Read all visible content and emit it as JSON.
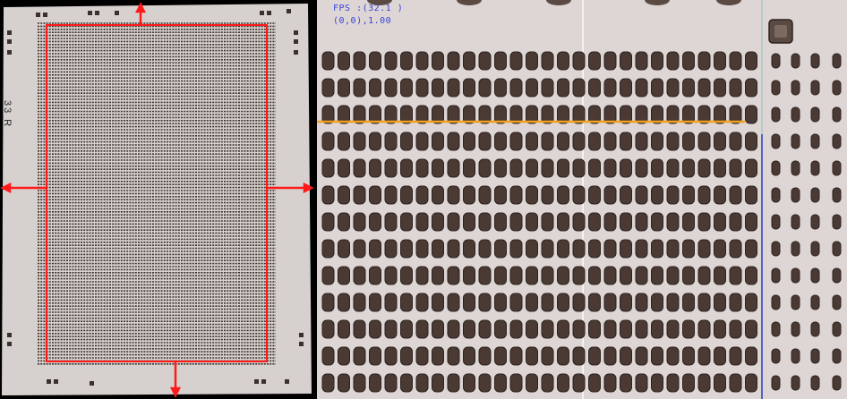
{
  "left_view": {
    "die_label": "33 R",
    "colors": {
      "die": "#d9d4d1",
      "pads": "#3b302c",
      "boundary": "#ff1a1a"
    }
  },
  "right_view": {
    "overlay_lines": [
      "FPS :(32.1 )",
      "(0,0),1.00"
    ],
    "colors": {
      "background": "#ddd6d4",
      "pads": "#4a3a33",
      "scanline": "#f0a020",
      "vertical_line": "#2a3ac8"
    }
  }
}
